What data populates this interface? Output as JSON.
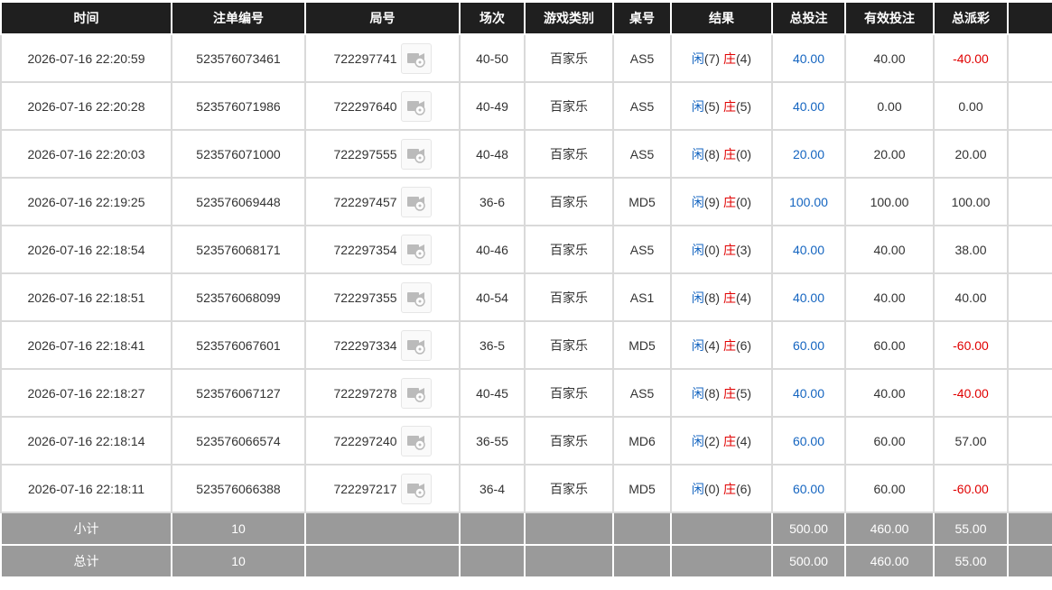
{
  "columns": [
    "时间",
    "注单编号",
    "局号",
    "场次",
    "游戏类别",
    "桌号",
    "结果",
    "总投注",
    "有效投注",
    "总派彩"
  ],
  "result_labels": {
    "player": "闲",
    "banker": "庄"
  },
  "rows": [
    {
      "time": "2026-07-16 22:20:59",
      "bet_id": "523576073461",
      "round": "722297741",
      "shoe": "40-50",
      "game": "百家乐",
      "table": "AS5",
      "player_score": "(7)",
      "banker_score": "(4)",
      "total_bet": "40.00",
      "valid_bet": "40.00",
      "payout": "-40.00",
      "payout_negative": true
    },
    {
      "time": "2026-07-16 22:20:28",
      "bet_id": "523576071986",
      "round": "722297640",
      "shoe": "40-49",
      "game": "百家乐",
      "table": "AS5",
      "player_score": "(5)",
      "banker_score": "(5)",
      "total_bet": "40.00",
      "valid_bet": "0.00",
      "payout": "0.00",
      "payout_negative": false
    },
    {
      "time": "2026-07-16 22:20:03",
      "bet_id": "523576071000",
      "round": "722297555",
      "shoe": "40-48",
      "game": "百家乐",
      "table": "AS5",
      "player_score": "(8)",
      "banker_score": "(0)",
      "total_bet": "20.00",
      "valid_bet": "20.00",
      "payout": "20.00",
      "payout_negative": false
    },
    {
      "time": "2026-07-16 22:19:25",
      "bet_id": "523576069448",
      "round": "722297457",
      "shoe": "36-6",
      "game": "百家乐",
      "table": "MD5",
      "player_score": "(9)",
      "banker_score": "(0)",
      "total_bet": "100.00",
      "valid_bet": "100.00",
      "payout": "100.00",
      "payout_negative": false
    },
    {
      "time": "2026-07-16 22:18:54",
      "bet_id": "523576068171",
      "round": "722297354",
      "shoe": "40-46",
      "game": "百家乐",
      "table": "AS5",
      "player_score": "(0)",
      "banker_score": "(3)",
      "total_bet": "40.00",
      "valid_bet": "40.00",
      "payout": "38.00",
      "payout_negative": false
    },
    {
      "time": "2026-07-16 22:18:51",
      "bet_id": "523576068099",
      "round": "722297355",
      "shoe": "40-54",
      "game": "百家乐",
      "table": "AS1",
      "player_score": "(8)",
      "banker_score": "(4)",
      "total_bet": "40.00",
      "valid_bet": "40.00",
      "payout": "40.00",
      "payout_negative": false
    },
    {
      "time": "2026-07-16 22:18:41",
      "bet_id": "523576067601",
      "round": "722297334",
      "shoe": "36-5",
      "game": "百家乐",
      "table": "MD5",
      "player_score": "(4)",
      "banker_score": "(6)",
      "total_bet": "60.00",
      "valid_bet": "60.00",
      "payout": "-60.00",
      "payout_negative": true
    },
    {
      "time": "2026-07-16 22:18:27",
      "bet_id": "523576067127",
      "round": "722297278",
      "shoe": "40-45",
      "game": "百家乐",
      "table": "AS5",
      "player_score": "(8)",
      "banker_score": "(5)",
      "total_bet": "40.00",
      "valid_bet": "40.00",
      "payout": "-40.00",
      "payout_negative": true
    },
    {
      "time": "2026-07-16 22:18:14",
      "bet_id": "523576066574",
      "round": "722297240",
      "shoe": "36-55",
      "game": "百家乐",
      "table": "MD6",
      "player_score": "(2)",
      "banker_score": "(4)",
      "total_bet": "60.00",
      "valid_bet": "60.00",
      "payout": "57.00",
      "payout_negative": false
    },
    {
      "time": "2026-07-16 22:18:11",
      "bet_id": "523576066388",
      "round": "722297217",
      "shoe": "36-4",
      "game": "百家乐",
      "table": "MD5",
      "player_score": "(0)",
      "banker_score": "(6)",
      "total_bet": "60.00",
      "valid_bet": "60.00",
      "payout": "-60.00",
      "payout_negative": true
    }
  ],
  "subtotal": {
    "label": "小计",
    "count": "10",
    "total_bet": "500.00",
    "valid_bet": "460.00",
    "payout": "55.00"
  },
  "grand_total": {
    "label": "总计",
    "count": "10",
    "total_bet": "500.00",
    "valid_bet": "460.00",
    "payout": "55.00"
  },
  "icons": {
    "replay": "video-replay-icon"
  },
  "colors": {
    "header_bg": "#1f1f1f",
    "footer_bg": "#9a9a9a",
    "blue": "#1565c0",
    "red": "#e00000"
  }
}
